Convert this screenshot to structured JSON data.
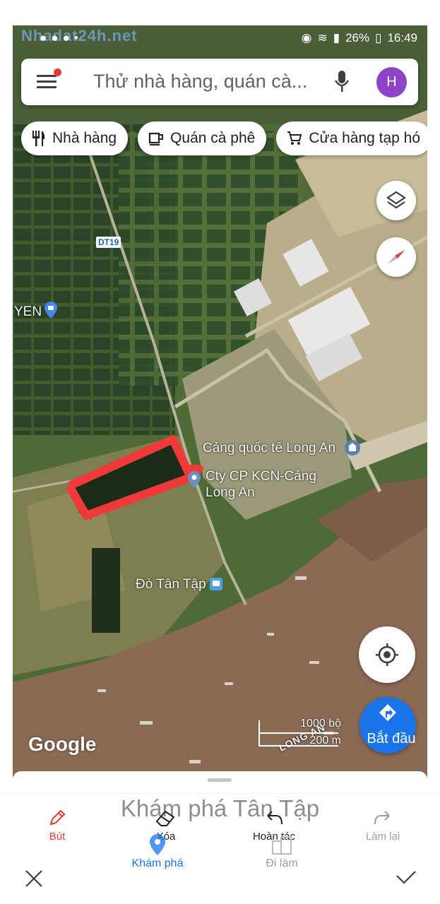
{
  "watermark": "Nhadat24h.net",
  "status_bar": {
    "battery": "26%",
    "time": "16:49"
  },
  "search": {
    "placeholder": "Thử nhà hàng, quán cà...",
    "avatar_letter": "H"
  },
  "chips": [
    {
      "label": "Nhà hàng",
      "icon": "restaurant-icon"
    },
    {
      "label": "Quán cà phê",
      "icon": "coffee-icon"
    },
    {
      "label": "Cửa hàng tạp hó",
      "icon": "cart-icon"
    }
  ],
  "map": {
    "labels": {
      "road": "DT19",
      "yen": "YEN",
      "port": "Cảng quốc tế Long An",
      "company_line1": "Cty CP KCN-Cảng",
      "company_line2": "Long An",
      "ferry": "Đò Tân Tập",
      "province": "LONG AN"
    },
    "scale": {
      "imperial": "1000 bộ",
      "metric": "200 m"
    },
    "google": "Google"
  },
  "directions_button": "Bắt đầu",
  "bottom_sheet": {
    "title": "Khám phá Tân Tập"
  },
  "edit_tools": [
    {
      "label": "Bút",
      "icon": "pen-icon",
      "color": "#e53935"
    },
    {
      "label": "Xóa",
      "icon": "eraser-icon",
      "color": "#202124"
    },
    {
      "label": "Hoàn tác",
      "icon": "undo-icon",
      "color": "#202124"
    },
    {
      "label": "Làm lại",
      "icon": "redo-icon",
      "color": "#9e9e9e"
    }
  ],
  "nav": {
    "explore": "Khám phá",
    "commute": "Đi làm"
  },
  "colors": {
    "accent_blue": "#1a73e8",
    "avatar": "#8e44c8",
    "river": "#8b6a54",
    "markup_red": "#f03a3a"
  }
}
